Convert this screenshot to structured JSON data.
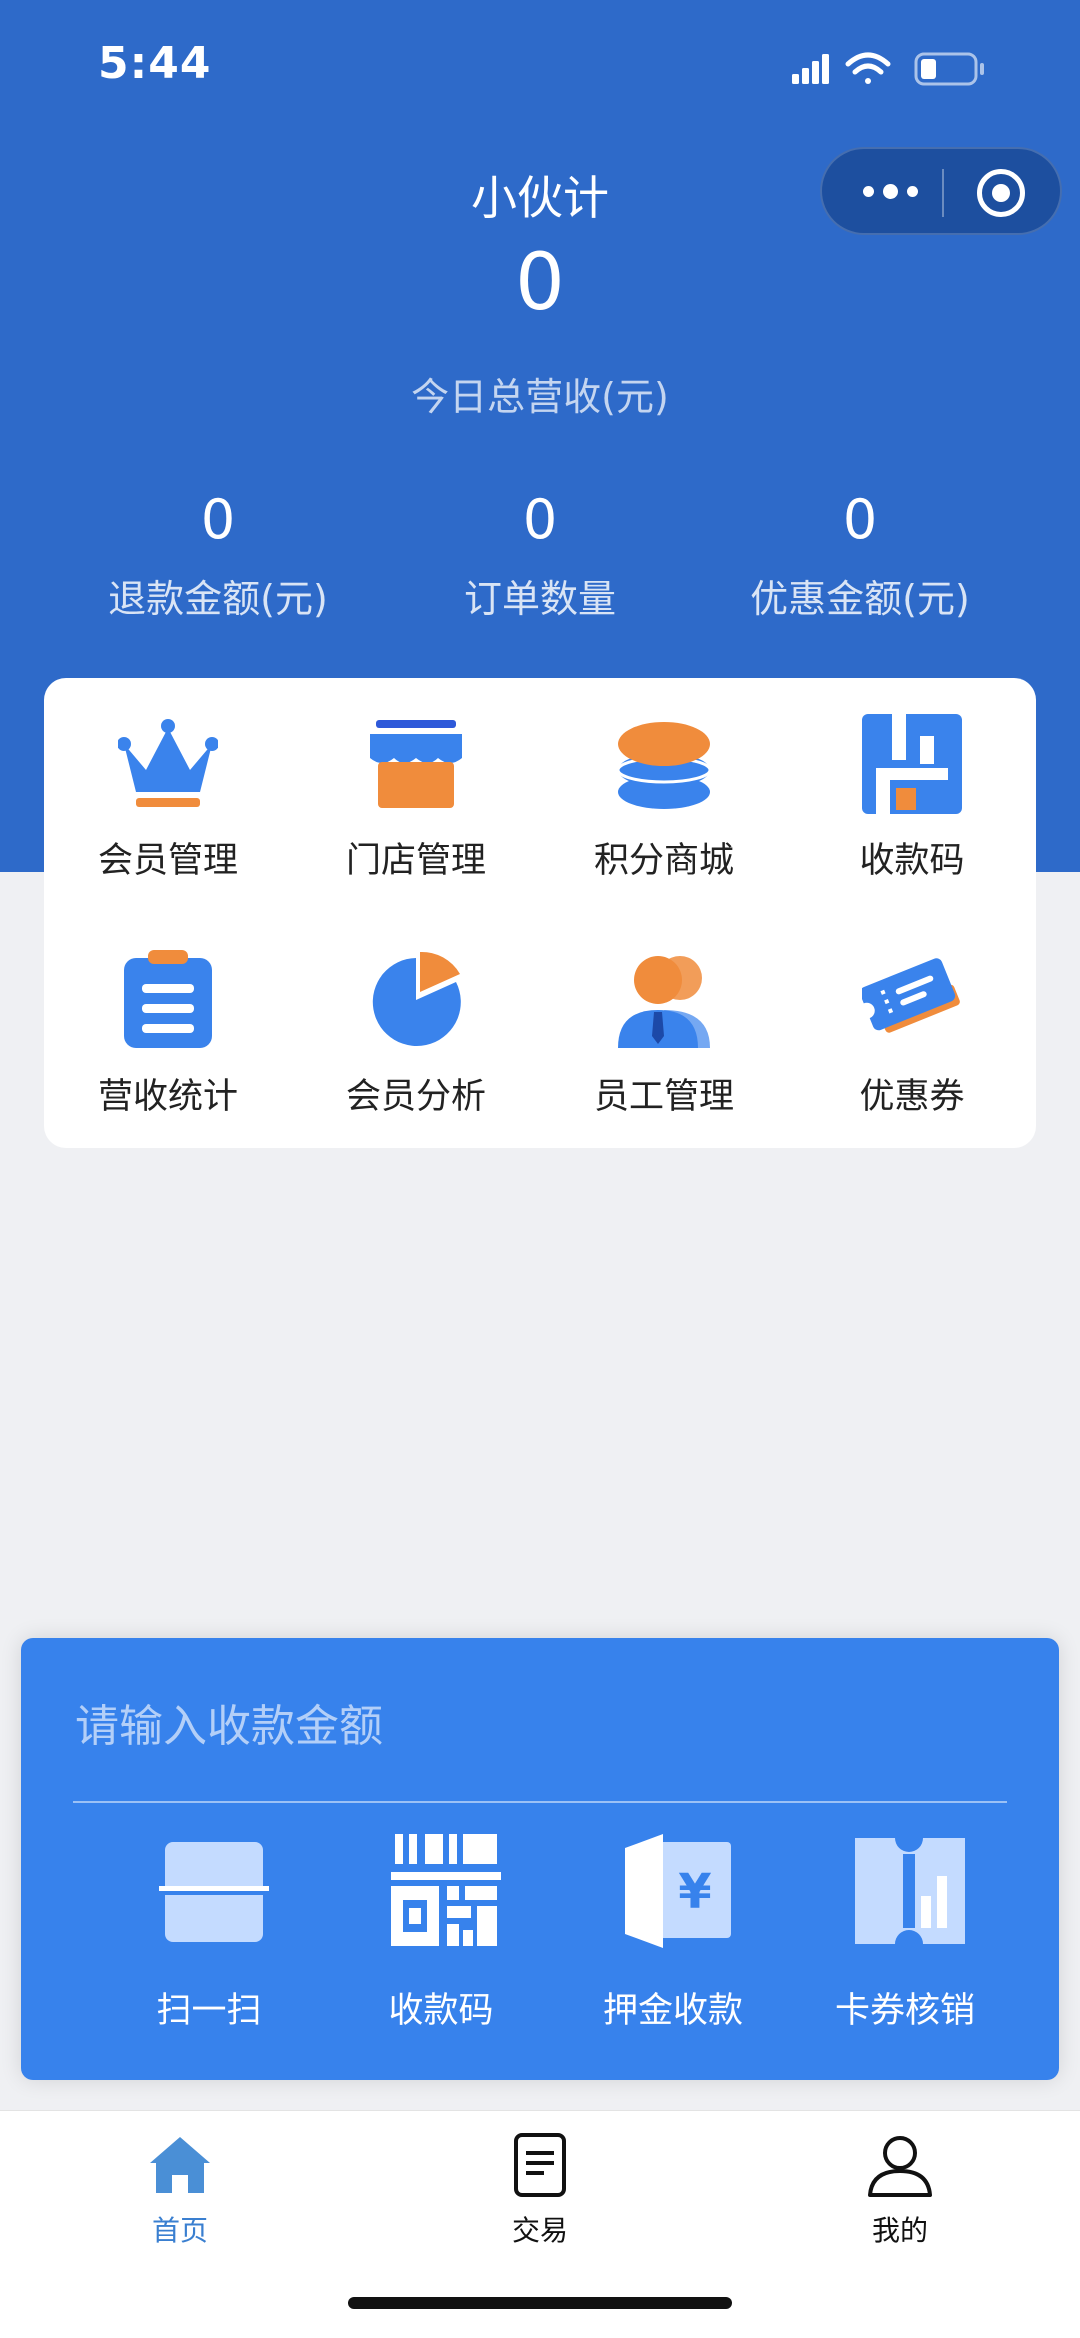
{
  "status_bar": {
    "time": "5:44"
  },
  "header": {
    "app_title": "小伙计",
    "total_revenue_value": "0",
    "total_revenue_label": "今日总营收(元)",
    "stats": [
      {
        "value": "0",
        "label": "退款金额(元)"
      },
      {
        "value": "0",
        "label": "订单数量"
      },
      {
        "value": "0",
        "label": "优惠金额(元)"
      }
    ]
  },
  "menu": {
    "items": [
      {
        "label": "会员管理",
        "icon": "crown-icon"
      },
      {
        "label": "门店管理",
        "icon": "storefront-icon"
      },
      {
        "label": "积分商城",
        "icon": "coin-stack-icon"
      },
      {
        "label": "收款码",
        "icon": "payment-code-icon"
      },
      {
        "label": "营收统计",
        "icon": "clipboard-icon"
      },
      {
        "label": "会员分析",
        "icon": "pie-chart-icon"
      },
      {
        "label": "员工管理",
        "icon": "staff-icon"
      },
      {
        "label": "优惠券",
        "icon": "coupon-icon"
      }
    ]
  },
  "payment_panel": {
    "amount_placeholder": "请输入收款金额",
    "actions": [
      {
        "label": "扫一扫",
        "icon": "scan-icon"
      },
      {
        "label": "收款码",
        "icon": "qr-code-icon"
      },
      {
        "label": "押金收款",
        "icon": "deposit-icon"
      },
      {
        "label": "卡券核销",
        "icon": "ticket-verify-icon"
      }
    ]
  },
  "tabbar": {
    "tabs": [
      {
        "label": "首页",
        "icon": "home-icon",
        "active": true
      },
      {
        "label": "交易",
        "icon": "document-icon",
        "active": false
      },
      {
        "label": "我的",
        "icon": "user-icon",
        "active": false
      }
    ]
  },
  "colors": {
    "header_blue": "#2e6ac9",
    "panel_blue": "#3782ec",
    "icon_blue": "#3a83ec",
    "icon_orange": "#f08c3c",
    "page_background": "#eff0f3"
  }
}
